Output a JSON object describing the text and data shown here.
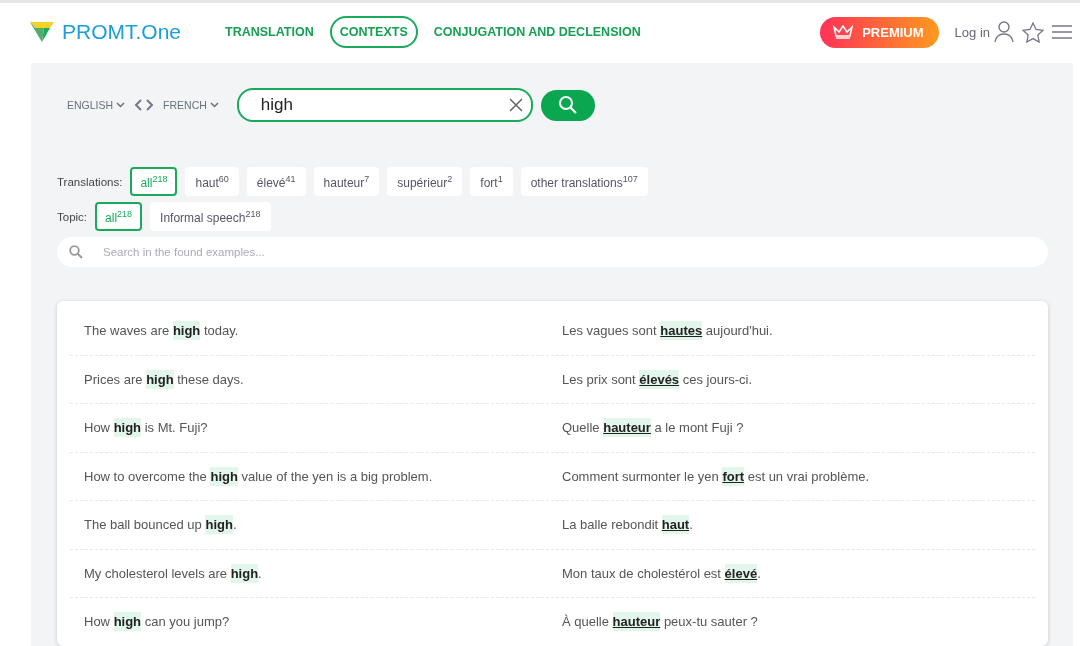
{
  "header": {
    "logo_text": "PROMT.One",
    "nav": [
      {
        "label": "TRANSLATION",
        "selected": false
      },
      {
        "label": "CONTEXTS",
        "selected": true
      },
      {
        "label": "CONJUGATION AND DECLENSION",
        "selected": false
      }
    ],
    "premium": "PREMIUM",
    "login": "Log in"
  },
  "languages": {
    "source": "ENGLISH",
    "target": "FRENCH"
  },
  "search": {
    "value": "high"
  },
  "translations": {
    "label": "Translations:",
    "chips": [
      {
        "label": "all",
        "count": "218",
        "selected": true
      },
      {
        "label": "haut",
        "count": "60",
        "selected": false
      },
      {
        "label": "élevé",
        "count": "41",
        "selected": false
      },
      {
        "label": "hauteur",
        "count": "7",
        "selected": false
      },
      {
        "label": "supérieur",
        "count": "2",
        "selected": false
      },
      {
        "label": "fort",
        "count": "1",
        "selected": false
      },
      {
        "label": "other translations",
        "count": "107",
        "selected": false
      }
    ]
  },
  "topic": {
    "label": "Topic:",
    "chips": [
      {
        "label": "all",
        "count": "218",
        "selected": true
      },
      {
        "label": "Informal speech",
        "count": "218",
        "selected": false
      }
    ]
  },
  "filter": {
    "placeholder": "Search in the found examples..."
  },
  "examples": [
    {
      "source": "The waves are **high** today.",
      "target": "Les vagues sont **hautes** aujourd'hui."
    },
    {
      "source": "Prices are **high** these days.",
      "target": "Les prix sont **élevés** ces jours-ci."
    },
    {
      "source": "How **high** is Mt. Fuji?",
      "target": "Quelle **hauteur** a le mont Fuji ?"
    },
    {
      "source": "How to overcome the **high** value of the yen is a big problem.",
      "target": "Comment surmonter le yen **fort** est un vrai problème."
    },
    {
      "source": "The ball bounced up **high**.",
      "target": "La balle rebondit **haut**."
    },
    {
      "source": "My cholesterol levels are **high**.",
      "target": "Mon taux de cholestérol est **élevé**."
    },
    {
      "source": "How **high** can you jump?",
      "target": "À quelle **hauteur** peux-tu sauter ?"
    }
  ]
}
